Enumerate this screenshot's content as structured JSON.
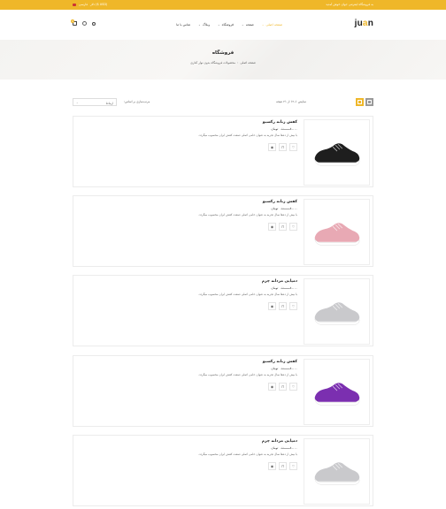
{
  "topbar": {
    "promo": "به فروشگاه اینترنتی جوان خوش آمدید",
    "currency": "دلار ($ USD)",
    "language": "فارسی"
  },
  "header": {
    "logo_prefix": "ju",
    "logo_highlight": "a",
    "logo_suffix": "n",
    "nav": [
      {
        "label": "صفحه اصلی",
        "active": true
      },
      {
        "label": "صفحه",
        "active": false
      },
      {
        "label": "فروشگاه",
        "active": false
      },
      {
        "label": "وبلاگ",
        "active": false
      },
      {
        "label": "تماس با ما",
        "active": false
      }
    ],
    "cart_count": "0"
  },
  "hero": {
    "title": "فروشگاه",
    "crumb_home": "صفحه اصلی",
    "crumb_current": "محصولات فروشگاه بدون نوار کناری"
  },
  "toolbar": {
    "result_count": "نمایش ۱–۱۲ از ۲۱ نتیجه",
    "sort_label": "مرتب‌سازی بر اساس:",
    "sort_value": "ارتباط"
  },
  "products": [
    {
      "name": "کفش زنانه رکسیو",
      "old_price": "۱۱۰.۰۰",
      "price": "۸۰.۰۰ تومان",
      "desc": "با بیش از ده‌ها سال تجربه به عنوان حامی اصلی صنعت کفش ایران محسوب میگردد.",
      "shoe_color": "#1e1e1e",
      "sole_color": "#ffffff"
    },
    {
      "name": "کفش زنانه رکسیو",
      "old_price": "۱۱۰.۰۰",
      "price": "۸۰.۰۰ تومان",
      "desc": "با بیش از ده‌ها سال تجربه به عنوان حامی اصلی صنعت کفش ایران محسوب میگردد.",
      "shoe_color": "#e8a9b4",
      "sole_color": "#ffffff"
    },
    {
      "name": "دمپایی مردانه چرم",
      "old_price": "۱۱۰.۰۰",
      "price": "۸۰.۰۰ تومان",
      "desc": "با بیش از ده‌ها سال تجربه به عنوان حامی اصلی صنعت کفش ایران محسوب میگردد.",
      "shoe_color": "#c9c9cc",
      "sole_color": "#ffffff"
    },
    {
      "name": "کفش زنانه رکسیو",
      "old_price": "۱۱۰.۰۰",
      "price": "۸۰.۰۰ تومان",
      "desc": "با بیش از ده‌ها سال تجربه به عنوان حامی اصلی صنعت کفش ایران محسوب میگردد.",
      "shoe_color": "#7b2fb0",
      "sole_color": "#ffffff"
    },
    {
      "name": "دمپایی مردانه چرم",
      "old_price": "۱۱۰.۰۰",
      "price": "۸۰.۰۰ تومان",
      "desc": "با بیش از ده‌ها سال تجربه به عنوان حامی اصلی صنعت کفش ایران محسوب میگردد.",
      "shoe_color": "#c9c9cc",
      "sole_color": "#ffffff"
    }
  ],
  "colors": {
    "accent": "#efb729"
  },
  "icons": {
    "cart": "cart-icon",
    "user": "user-icon",
    "search": "search-icon",
    "wishlist": "heart-icon",
    "add_to_cart": "bag-icon",
    "quickview": "eye-icon"
  }
}
